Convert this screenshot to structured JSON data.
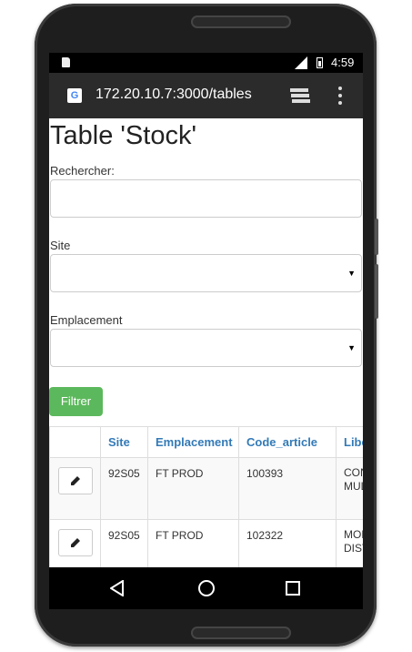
{
  "statusbar": {
    "network": "3G",
    "time": "4:59"
  },
  "browser": {
    "url": "172.20.10.7:3000/tables",
    "favicon_letter": "G"
  },
  "page": {
    "title": "Table 'Stock'",
    "search": {
      "label": "Rechercher:",
      "value": "",
      "placeholder": ""
    },
    "site": {
      "label": "Site",
      "selected": ""
    },
    "emplacement": {
      "label": "Emplacement",
      "selected": ""
    },
    "filter_button": "Filtrer"
  },
  "table": {
    "columns": [
      "",
      "Site",
      "Emplacement",
      "Code_article",
      "Libe"
    ],
    "rows": [
      {
        "site": "92S05",
        "emplacement": "FT PROD",
        "code_article": "100393",
        "libelle": "CON POU MUL"
      },
      {
        "site": "92S05",
        "emplacement": "FT PROD",
        "code_article": "102322",
        "libelle": "MOD RAC DIST"
      }
    ]
  },
  "icons": {
    "edit": "pencil-icon",
    "back": "back-triangle-icon",
    "home": "home-circle-icon",
    "recent": "recent-apps-square-icon"
  }
}
